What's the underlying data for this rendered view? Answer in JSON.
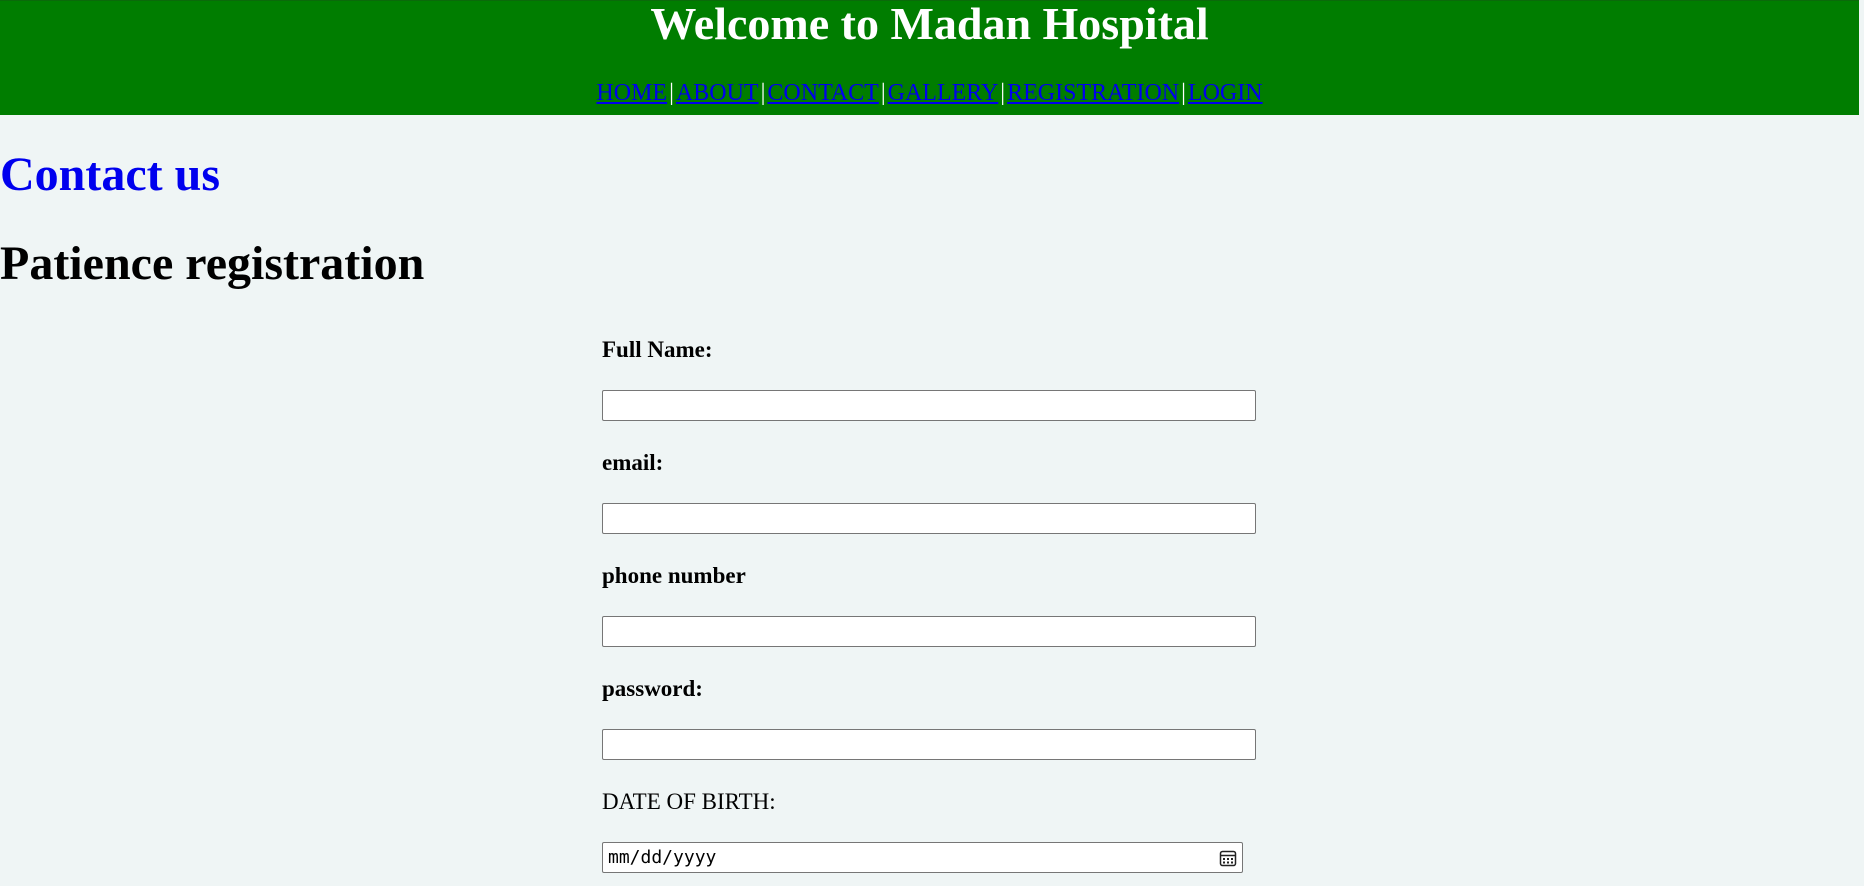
{
  "header": {
    "title": "Welcome to Madan Hospital",
    "nav": [
      {
        "label": "HOME"
      },
      {
        "label": "ABOUT"
      },
      {
        "label": "CONTACT"
      },
      {
        "label": "GALLERY"
      },
      {
        "label": "REGISTRATION"
      },
      {
        "label": "LOGIN"
      }
    ],
    "separator": "|",
    "background_color": "#007d00"
  },
  "contact_heading": "Contact us",
  "registration_heading": "Patience registration",
  "form": {
    "full_name_label": "Full Name:",
    "full_name_value": "",
    "email_label": "email:",
    "email_value": "",
    "phone_label": "phone number",
    "phone_value": "",
    "password_label": "password:",
    "password_value": "",
    "dob_label": "DATE OF BIRTH:",
    "dob_placeholder": "mm/dd/yyyy"
  },
  "icons": {
    "dob_picker": "calendar-icon"
  },
  "colors": {
    "page_background": "#eff5f5",
    "link": "#0000ee",
    "header_text": "#ffffff"
  }
}
